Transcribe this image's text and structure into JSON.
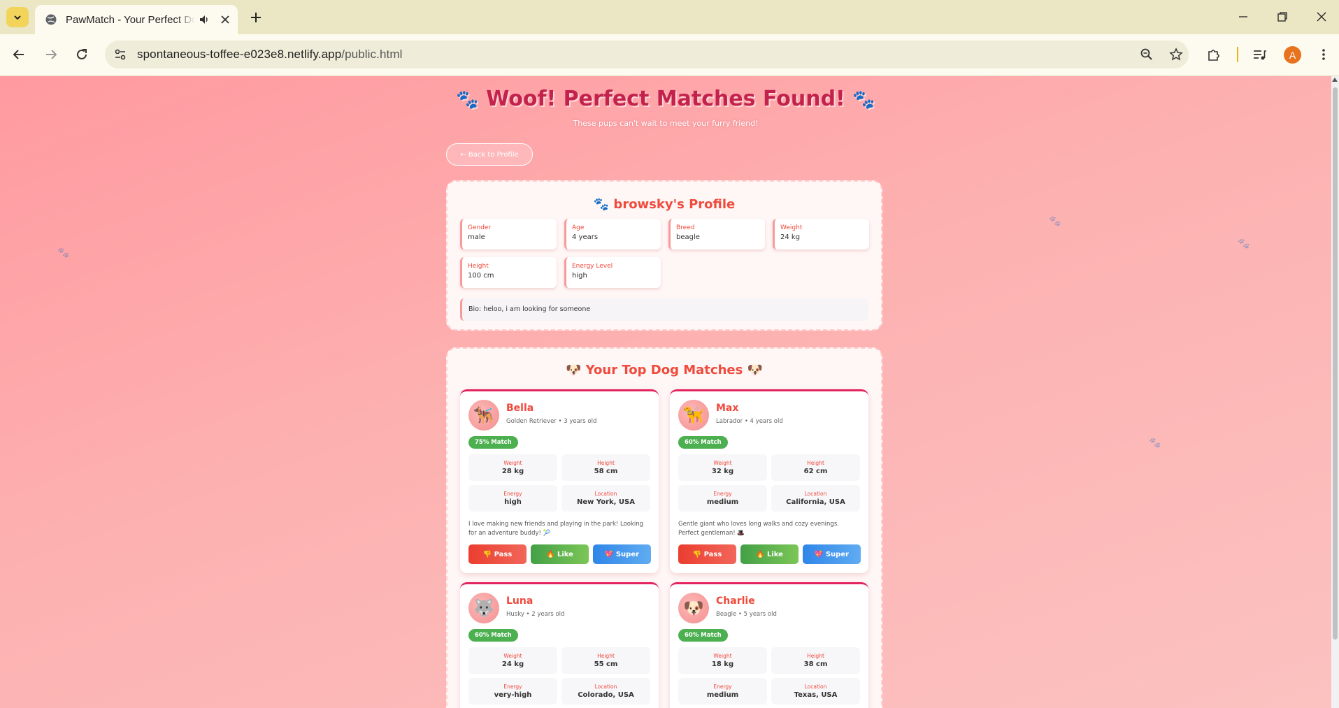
{
  "browser": {
    "tab_title": "PawMatch - Your Perfect Dog Match",
    "url_domain": "spontaneous-toffee-e023e8.netlify.app",
    "url_path": "/public.html",
    "profile_initial": "A"
  },
  "header": {
    "title": "Woof! Perfect Matches Found!",
    "paw_glyph": "🐾",
    "subtitle": "These pups can't wait to meet your furry friend!",
    "back_label": "← Back to Profile"
  },
  "profile": {
    "title": "🐾 browsky's Profile",
    "fields": [
      {
        "label": "Gender",
        "value": "male"
      },
      {
        "label": "Age",
        "value": "4 years"
      },
      {
        "label": "Breed",
        "value": "beagle"
      },
      {
        "label": "Weight",
        "value": "24 kg"
      },
      {
        "label": "Height",
        "value": "100 cm"
      },
      {
        "label": "Energy Level",
        "value": "high"
      }
    ],
    "bio": "Bio: heloo, i am looking for someone"
  },
  "matches": {
    "title": "🐶 Your Top Dog Matches 🐶",
    "labels": {
      "weight": "Weight",
      "height": "Height",
      "energy": "Energy",
      "location": "Location"
    },
    "buttons": {
      "pass": "👎 Pass",
      "like": "🔥 Like",
      "super": "💖 Super"
    },
    "items": [
      {
        "emoji": "🐕‍🦺",
        "name": "Bella",
        "sub": "Golden Retriever • 3 years old",
        "match": "75% Match",
        "weight": "28 kg",
        "height": "58 cm",
        "energy": "high",
        "location": "New York, USA",
        "desc": "I love making new friends and playing in the park! Looking for an adventure buddy! 🎾"
      },
      {
        "emoji": "🦮",
        "name": "Max",
        "sub": "Labrador • 4 years old",
        "match": "60% Match",
        "weight": "32 kg",
        "height": "62 cm",
        "energy": "medium",
        "location": "California, USA",
        "desc": "Gentle giant who loves long walks and cozy evenings. Perfect gentleman! 🎩"
      },
      {
        "emoji": "🐺",
        "name": "Luna",
        "sub": "Husky • 2 years old",
        "match": "60% Match",
        "weight": "24 kg",
        "height": "55 cm",
        "energy": "very-high",
        "location": "Colorado, USA",
        "desc": ""
      },
      {
        "emoji": "🐶",
        "name": "Charlie",
        "sub": "Beagle • 5 years old",
        "match": "60% Match",
        "weight": "18 kg",
        "height": "38 cm",
        "energy": "medium",
        "location": "Texas, USA",
        "desc": ""
      }
    ]
  },
  "colors": {
    "accent": "#ef4a3c",
    "title": "#c2224b",
    "match_badge": "#4caf50",
    "pass": "#ea3e30",
    "like": "#43a047",
    "super": "#2f86e8"
  }
}
